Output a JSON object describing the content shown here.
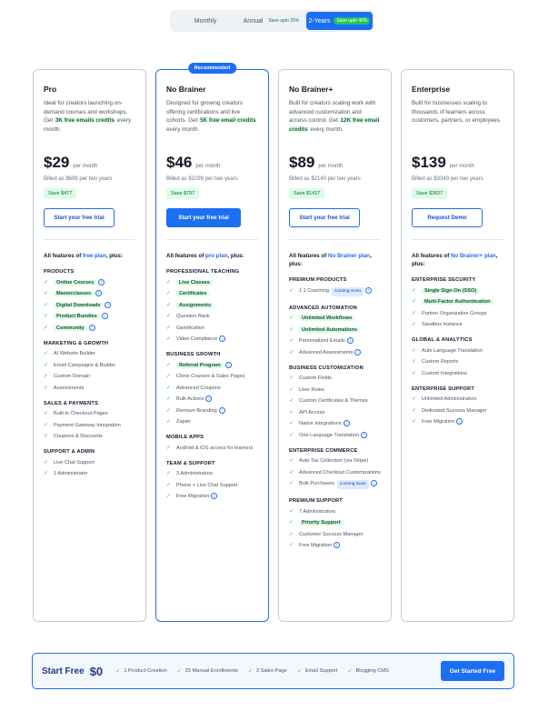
{
  "billing": {
    "monthly": "Monthly",
    "annual": "Annual",
    "annual_save": "Save upto 25%",
    "two_years": "2-Years",
    "two_years_save": "Save upto 40%"
  },
  "plans": [
    {
      "name": "Pro",
      "desc_pre": "Ideal for creators launching on-demand courses and workshops. Get ",
      "desc_hl": "3K free emails credits",
      "desc_post": " every month.",
      "price": "$29",
      "per": "per month",
      "billed": "Billed as $699 per two years",
      "save": "Save $477",
      "cta": "Start your free trial",
      "all_pre": "All features of ",
      "all_link": "free plan",
      "all_post": ", plus:",
      "sections": [
        {
          "title": "PRODUCTS",
          "features": [
            {
              "text": "Online Courses",
              "hl": true,
              "info": true
            },
            {
              "text": "Masterclasses",
              "hl": true,
              "info": true
            },
            {
              "text": "Digital Downloads",
              "hl": true,
              "info": true
            },
            {
              "text": "Product Bundles",
              "hl": true,
              "info": true
            },
            {
              "text": "Community",
              "hl": true,
              "info": true
            }
          ]
        },
        {
          "title": "MARKETING & GROWTH",
          "features": [
            {
              "text": "AI Website Builder"
            },
            {
              "text": "Email Campaigns & Builder"
            },
            {
              "text": "Custom Domain"
            },
            {
              "text": "Assessments"
            }
          ]
        },
        {
          "title": "SALES & PAYMENTS",
          "features": [
            {
              "text": "Built-in Checkout Pages"
            },
            {
              "text": "Payment Gateway Integration"
            },
            {
              "text": "Coupons & Discounts"
            }
          ]
        },
        {
          "title": "SUPPORT & ADMIN",
          "features": [
            {
              "text": "Live Chat Support"
            },
            {
              "text": "1 Administrator"
            }
          ]
        }
      ]
    },
    {
      "name": "No Brainer",
      "badge": "Recommended",
      "desc_pre": "Designed for growing creators offering certifications and live cohorts. Get ",
      "desc_hl": "5K free email credits",
      "desc_post": " every month.",
      "price": "$46",
      "per": "per month",
      "billed": "Billed as $1099 per two years",
      "save": "Save $797",
      "cta": "Start your free trial",
      "all_pre": "All features of ",
      "all_link": "pro plan",
      "all_post": ", plus:",
      "sections": [
        {
          "title": "PROFESSIONAL TEACHING",
          "features": [
            {
              "text": "Live Classes",
              "hl": true
            },
            {
              "text": "Certificates",
              "hl": true
            },
            {
              "text": "Assignments",
              "hl": true
            },
            {
              "text": "Question Bank"
            },
            {
              "text": "Gamification"
            },
            {
              "text": "Video Compliance",
              "info": true
            }
          ]
        },
        {
          "title": "BUSINESS GROWTH",
          "features": [
            {
              "text": "Referral Program",
              "hl": true,
              "info": true
            },
            {
              "text": "Clone Courses & Sales Pages"
            },
            {
              "text": "Advanced Coupons"
            },
            {
              "text": "Bulk Actions",
              "info": true
            },
            {
              "text": "Remove Branding",
              "info": true
            },
            {
              "text": "Zapier"
            }
          ]
        },
        {
          "title": "MOBILE APPS",
          "features": [
            {
              "text": "Android & iOS access for learners"
            }
          ]
        },
        {
          "title": "TEAM & SUPPORT",
          "features": [
            {
              "text": "3 Administrators"
            },
            {
              "text": "Phone + Live Chat Support"
            },
            {
              "text": "Free Migration",
              "info": true
            }
          ]
        }
      ]
    },
    {
      "name": "No Brainer+",
      "desc_pre": "Built for creators scaling work with advanced customization and access control. Get ",
      "desc_hl": "12K free email credits",
      "desc_post": " every month.",
      "price": "$89",
      "per": "per month",
      "billed": "Billed as $2140 per two years",
      "save": "Save $1427",
      "cta": "Start your free trial",
      "all_pre": "All features of ",
      "all_link": "No Brainer plan",
      "all_post": ", plus:",
      "sections": [
        {
          "title": "PREMIUM PRODUCTS",
          "features": [
            {
              "text": "1:1 Coaching",
              "soon": "Coming Soon",
              "info": true
            }
          ]
        },
        {
          "title": "ADVANCED AUTOMATION",
          "features": [
            {
              "text": "Unlimited Workflows",
              "hl": true
            },
            {
              "text": "Unlimited Automations",
              "hl": true
            },
            {
              "text": "Personalized Emails",
              "info": true
            },
            {
              "text": "Advanced Assessments",
              "info": true
            }
          ]
        },
        {
          "title": "BUSINESS CUSTOMIZATION",
          "features": [
            {
              "text": "Custom Fields"
            },
            {
              "text": "User Roles"
            },
            {
              "text": "Custom Certificates & Themes"
            },
            {
              "text": "API Access"
            },
            {
              "text": "Native Integrations",
              "info": true
            },
            {
              "text": "One Language Translation",
              "info": true
            }
          ]
        },
        {
          "title": "ENTERPRISE COMMERCE",
          "features": [
            {
              "text": "Auto Tax Collection (via Stripe)"
            },
            {
              "text": "Advanced Checkout Customizations"
            },
            {
              "text": "Bulk Purchases",
              "soon": "Coming Soon",
              "info": true
            }
          ]
        },
        {
          "title": "PREMIUM SUPPORT",
          "features": [
            {
              "text": "7 Administrators"
            },
            {
              "text": "Priority Support",
              "hl": true
            },
            {
              "text": "Customer Success Manager"
            },
            {
              "text": "Free Migration",
              "info": true
            }
          ]
        }
      ]
    },
    {
      "name": "Enterprise",
      "desc_pre": "Built for businesses scaling to thousands of learners across customers, partners, or employees",
      "desc_hl": "",
      "desc_post": "",
      "price": "$139",
      "per": "per month",
      "billed": "Billed as $3349 per two years",
      "save": "Save $2827",
      "cta": "Request Demo",
      "all_pre": "All features of ",
      "all_link": "No Brainer+ plan",
      "all_post": ", plus:",
      "sections": [
        {
          "title": "ENTERPRISE SECURITY",
          "features": [
            {
              "text": "Single Sign-On (SSO)",
              "hl": true
            },
            {
              "text": "Multi-Factor Authentication",
              "hl": true
            },
            {
              "text": "Partner Organization Groups"
            },
            {
              "text": "Sandbox Instance"
            }
          ]
        },
        {
          "title": "GLOBAL & ANALYTICS",
          "features": [
            {
              "text": "Auto Language Translation"
            },
            {
              "text": "Custom Reports"
            },
            {
              "text": "Custom Integrations"
            }
          ]
        },
        {
          "title": "ENTERPRISE SUPPORT",
          "features": [
            {
              "text": "Unlimited Administrators"
            },
            {
              "text": "Dedicated Success Manager"
            },
            {
              "text": "Free Migration",
              "info": true
            }
          ]
        }
      ]
    }
  ],
  "free": {
    "title": "Start Free",
    "price": "$0",
    "items": [
      "1 Product Creation",
      "25 Manual Enrollments",
      "3 Sales Page",
      "Email Support",
      "Blogging CMS"
    ],
    "cta": "Get Started Free"
  },
  "icons": {
    "check": "check-icon",
    "info": "info-icon"
  },
  "colors": {
    "accent": "#1d6ff2",
    "success": "#22c55e"
  }
}
